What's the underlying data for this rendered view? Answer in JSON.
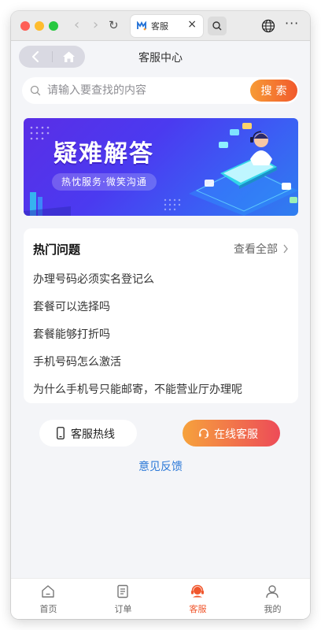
{
  "browser": {
    "tab_title": "客服",
    "tab_close": "×",
    "more_menu": "···",
    "reload_glyph": "↻",
    "back_glyph": "‹",
    "forward_glyph": "›"
  },
  "header": {
    "title": "客服中心"
  },
  "search": {
    "placeholder": "请输入要查找的内容",
    "button_label": "搜索"
  },
  "banner": {
    "title": "疑难解答",
    "subtitle": "热忱服务·微笑沟通"
  },
  "hot_questions": {
    "title": "热门问题",
    "view_all": "查看全部",
    "items": [
      "办理号码必须实名登记么",
      "套餐可以选择吗",
      "套餐能够打折吗",
      "手机号码怎么激活",
      "为什么手机号只能邮寄，不能营业厅办理呢"
    ]
  },
  "actions": {
    "hotline": "客服热线",
    "online": "在线客服",
    "feedback": "意见反馈"
  },
  "tabbar": {
    "items": [
      {
        "label": "首页",
        "icon": "home-icon"
      },
      {
        "label": "订单",
        "icon": "order-icon"
      },
      {
        "label": "客服",
        "icon": "service-icon",
        "active": true
      },
      {
        "label": "我的",
        "icon": "profile-icon"
      }
    ]
  },
  "colors": {
    "accent_orange": "#f0562c",
    "link_blue": "#2f7bd8",
    "banner_purple": "#5a2ee6"
  }
}
